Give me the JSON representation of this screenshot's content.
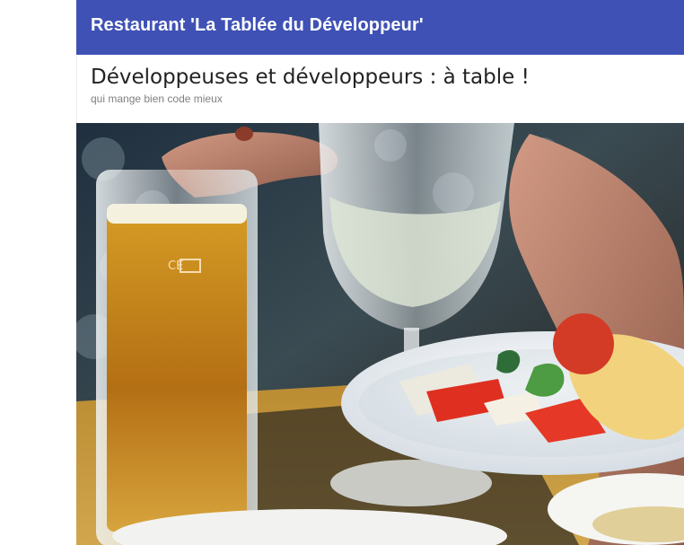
{
  "header": {
    "site_title": "Restaurant 'La Tablée du Développeur'"
  },
  "hero": {
    "title": "Développeuses et développeurs : à table !",
    "subtitle": "qui mange bien code mieux"
  },
  "photo": {
    "subject": "dinner-table-photo"
  },
  "colors": {
    "header_background": "#3f51b5",
    "header_text": "#ffffff",
    "page_background": "#ffffff",
    "subtitle_text": "#808080"
  }
}
